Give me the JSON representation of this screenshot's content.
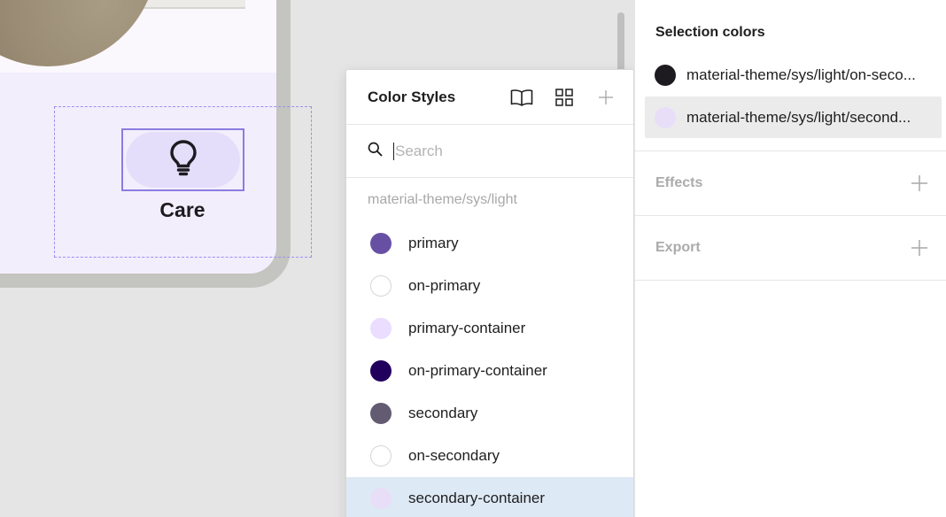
{
  "canvas": {
    "card_label": "Care",
    "card_icon": "lightbulb-icon"
  },
  "color_styles": {
    "title": "Color Styles",
    "header_icons": [
      "book-icon",
      "grid-view-icon",
      "add-icon"
    ],
    "search": {
      "placeholder": "Search",
      "value": ""
    },
    "group": "material-theme/sys/light",
    "items": [
      {
        "label": "primary",
        "color": "#6750a4"
      },
      {
        "label": "on-primary",
        "color": "#ffffff"
      },
      {
        "label": "primary-container",
        "color": "#eaddff"
      },
      {
        "label": "on-primary-container",
        "color": "#21005d"
      },
      {
        "label": "secondary",
        "color": "#625b71"
      },
      {
        "label": "on-secondary",
        "color": "#ffffff"
      },
      {
        "label": "secondary-container",
        "color": "#e8def8"
      }
    ]
  },
  "panel": {
    "selection_colors": {
      "heading": "Selection colors",
      "items": [
        {
          "label": "material-theme/sys/light/on-seco...",
          "color": "#1d1b20"
        },
        {
          "label": "material-theme/sys/light/second...",
          "color": "#e8def8"
        }
      ]
    },
    "effects": {
      "title": "Effects"
    },
    "export": {
      "title": "Export"
    }
  }
}
